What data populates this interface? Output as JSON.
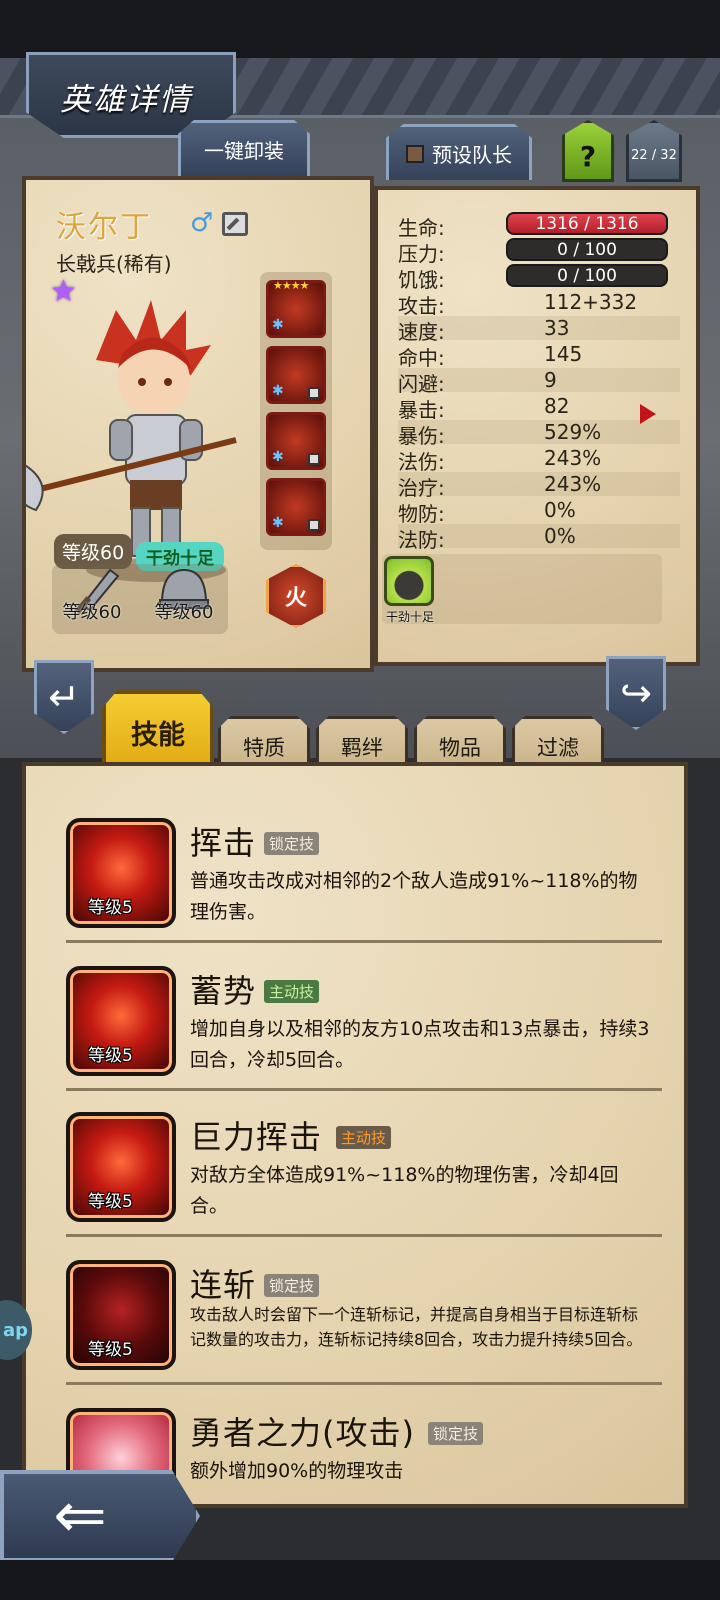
{
  "header": {
    "title": "英雄详情",
    "unequip_all": "一键卸装",
    "preset_captain": "预设队长",
    "help": "?",
    "hero_count": "22 / 32"
  },
  "hero": {
    "name": "沃尔丁",
    "class": "长戟兵(稀有)",
    "level": "等级60",
    "mood": "干劲十足",
    "weapon_level": "等级60",
    "armor_level": "等级60",
    "element": "火"
  },
  "stats": {
    "hp_label": "生命:",
    "hp_value": "1316 / 1316",
    "stress_label": "压力:",
    "stress_value": "0 / 100",
    "hunger_label": "饥饿:",
    "hunger_value": "0 / 100",
    "rows": [
      {
        "label": "攻击:",
        "value": "112+332"
      },
      {
        "label": "速度:",
        "value": "33"
      },
      {
        "label": "命中:",
        "value": "145"
      },
      {
        "label": "闪避:",
        "value": "9"
      },
      {
        "label": "暴击:",
        "value": "82"
      },
      {
        "label": "暴伤:",
        "value": "529%"
      },
      {
        "label": "法伤:",
        "value": "243%"
      },
      {
        "label": "治疗:",
        "value": "243%"
      },
      {
        "label": "物防:",
        "value": "0%"
      },
      {
        "label": "法防:",
        "value": "0%"
      }
    ],
    "trait_label": "干劲十足"
  },
  "tabs": {
    "skills": "技能",
    "traits": "特质",
    "bonds": "羁绊",
    "items": "物品",
    "filter": "过滤"
  },
  "skills": [
    {
      "name": "挥击",
      "tag": "锁定技",
      "level": "等级5",
      "desc": "普通攻击改成对相邻的2个敌人造成91%~118%的物理伤害。"
    },
    {
      "name": "蓄势",
      "tag": "主动技",
      "level": "等级5",
      "desc": "增加自身以及相邻的友方10点攻击和13点暴击，持续3回合，冷却5回合。"
    },
    {
      "name": "巨力挥击",
      "tag": "主动技",
      "level": "等级5",
      "desc": "对敌方全体造成91%~118%的物理伤害，冷却4回合。"
    },
    {
      "name": "连斩",
      "tag": "锁定技",
      "level": "等级5",
      "desc": "攻击敌人时会留下一个连斩标记，并提高自身相当于目标连斩标记数量的攻击力，连斩标记持续8回合，攻击力提升持续5回合。"
    },
    {
      "name": "勇者之力(攻击)",
      "tag": "锁定技",
      "level": "",
      "desc": "额外增加90%的物理攻击"
    }
  ],
  "side_bubble": "ap"
}
